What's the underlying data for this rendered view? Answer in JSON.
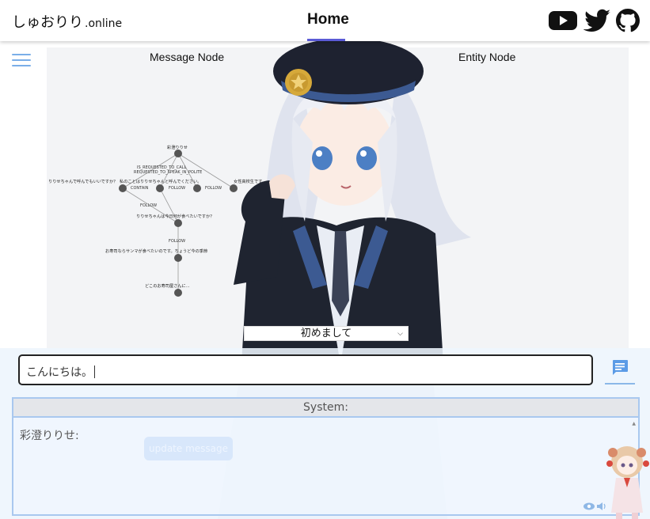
{
  "header": {
    "logo_name": "しゅおりり",
    "logo_tld": ".online",
    "nav_home": "Home",
    "social": [
      "youtube-icon",
      "twitter-icon",
      "github-icon"
    ]
  },
  "panels": {
    "message_title": "Message Node",
    "entity_title": "Entity Node"
  },
  "graph": {
    "nodes": [
      "彩澄りりせ",
      "りりせちゃんで呼んでもいいですか？",
      "私のことはりりせちゃんと呼んでください。",
      "りりせちゃんは今日何が食べたいですか？",
      "お寿司ならサンマが食べたいのです。ちょうど今の季節",
      "どこのお寿司屋さんに..."
    ],
    "edge_labels": [
      "IS_REQUESTED_TO_CALL",
      "REQUESTED_TO_SPEAK_IN_POLITE",
      "CONTAIN",
      "FOLLOW",
      "FOLLOW",
      "FOLLOW",
      "FOLLOW",
      "女性高校生です。"
    ]
  },
  "greeting_select": {
    "selected": "初めまして"
  },
  "chat": {
    "input_value": "こんにちは。",
    "send_icon": "message-icon"
  },
  "system": {
    "header": "System:",
    "speaker": "彩澄りりせ:",
    "update_button": "update message"
  },
  "colors": {
    "accent": "#5b5bd6",
    "hamburger": "#7aaee8",
    "send_icon": "#5b9be6",
    "panel_border": "#a9c8ef"
  }
}
